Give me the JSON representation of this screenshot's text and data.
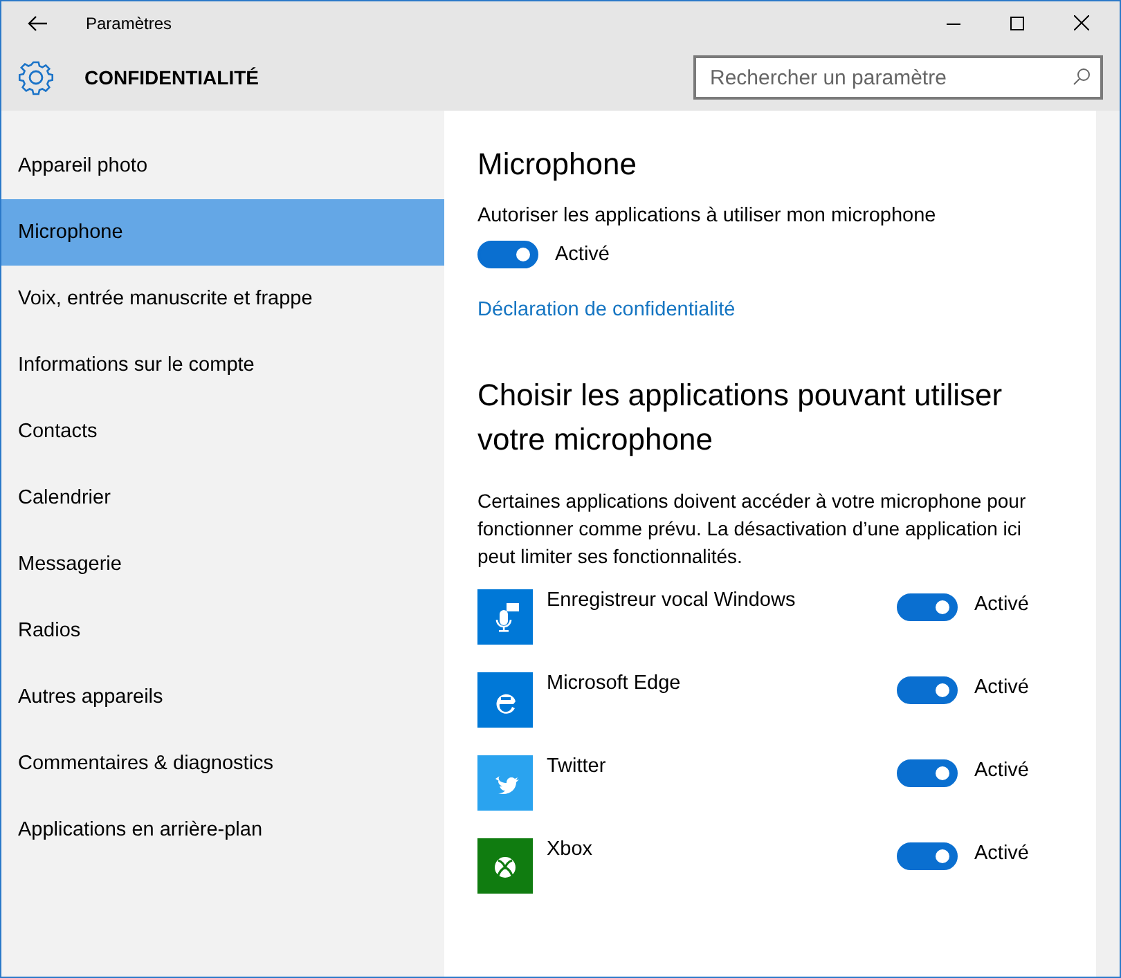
{
  "window": {
    "title": "Paramètres"
  },
  "header": {
    "title": "CONFIDENTIALITÉ",
    "search": {
      "placeholder": "Rechercher un paramètre"
    }
  },
  "sidebar": {
    "items": [
      {
        "label": "Appareil photo",
        "selected": false
      },
      {
        "label": "Microphone",
        "selected": true
      },
      {
        "label": "Voix, entrée manuscrite et frappe",
        "selected": false
      },
      {
        "label": "Informations sur le compte",
        "selected": false
      },
      {
        "label": "Contacts",
        "selected": false
      },
      {
        "label": "Calendrier",
        "selected": false
      },
      {
        "label": "Messagerie",
        "selected": false
      },
      {
        "label": "Radios",
        "selected": false
      },
      {
        "label": "Autres appareils",
        "selected": false
      },
      {
        "label": "Commentaires & diagnostics",
        "selected": false
      },
      {
        "label": "Applications en arrière-plan",
        "selected": false
      }
    ]
  },
  "content": {
    "title": "Microphone",
    "allow_label": "Autoriser les applications à utiliser mon microphone",
    "allow_toggle": {
      "on": true,
      "label": "Activé"
    },
    "privacy_link": "Déclaration de confidentialité",
    "apps_heading": "Choisir les applications pouvant utiliser votre microphone",
    "apps_description": "Certaines applications doivent accéder à votre microphone pour fonctionner comme prévu. La désactivation d’une application ici peut limiter ses fonctionnalités.",
    "apps": [
      {
        "name": "Enregistreur vocal Windows",
        "kind": "recorder",
        "color": "#0078d7",
        "on": true,
        "toggle_label": "Activé"
      },
      {
        "name": "Microsoft Edge",
        "kind": "browser",
        "color": "#0078d7",
        "on": true,
        "toggle_label": "Activé"
      },
      {
        "name": "Twitter",
        "kind": "bird",
        "color": "#2aa3ef",
        "on": true,
        "toggle_label": "Activé"
      },
      {
        "name": "Xbox",
        "kind": "xbox",
        "color": "#107c10",
        "on": true,
        "toggle_label": "Activé"
      }
    ]
  }
}
